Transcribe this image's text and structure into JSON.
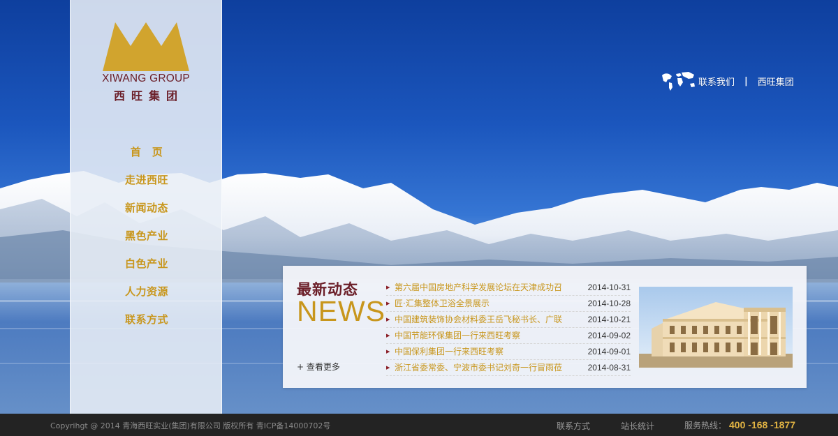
{
  "brand": {
    "name_en": "XIWANG GROUP",
    "name_cn": "西旺集团",
    "colors": {
      "gold": "#c8961c",
      "maroon": "#6b1e28"
    }
  },
  "top_links": {
    "icon": "world-map-icon",
    "contact": "联系我们",
    "separator": "|",
    "group": "西旺集团"
  },
  "nav": {
    "items": [
      {
        "label": "首　页"
      },
      {
        "label": "走进西旺"
      },
      {
        "label": "新闻动态"
      },
      {
        "label": "黑色产业"
      },
      {
        "label": "白色产业"
      },
      {
        "label": "人力资源"
      },
      {
        "label": "联系方式"
      }
    ]
  },
  "news": {
    "heading_cn": "最新动态",
    "heading_en": "NEWS",
    "more": "+ 查看更多",
    "items": [
      {
        "title": "第六届中国房地产科学发展论坛在天津成功召",
        "date": "2014-10-31"
      },
      {
        "title": "匠·汇集整体卫浴全景展示",
        "date": "2014-10-28"
      },
      {
        "title": "中国建筑装饰协会材料委王岳飞秘书长、广联",
        "date": "2014-10-21"
      },
      {
        "title": "中国节能环保集团一行来西旺考察",
        "date": "2014-09-02"
      },
      {
        "title": "中国保利集团一行来西旺考察",
        "date": "2014-09-01"
      },
      {
        "title": "浙江省委常委、宁波市委书记刘奇一行冒雨莅",
        "date": "2014-08-31"
      }
    ]
  },
  "footer": {
    "copyright": "Copyrihgt @ 2014 青海西旺实业(集团)有限公司 版权所有 青ICP备14000702号",
    "contact_link": "联系方式",
    "stats_link": "站长统计",
    "hotline_label": "服务热线：",
    "hotline_number": "400 -168 -1877"
  }
}
